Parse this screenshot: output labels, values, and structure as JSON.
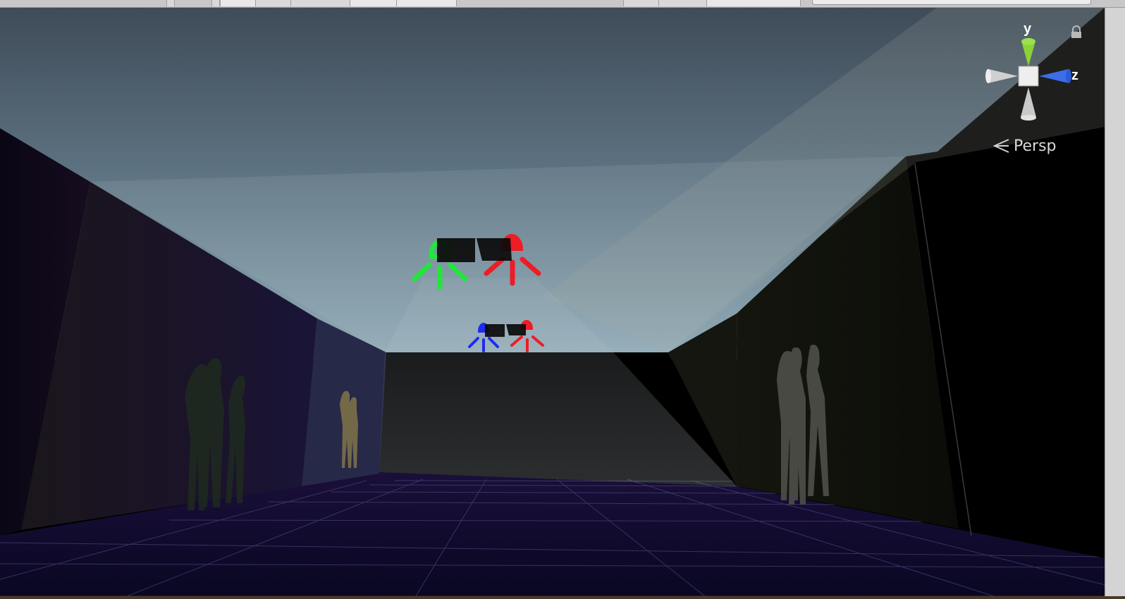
{
  "viewport": {
    "projection_label": "Persp",
    "projection_icon": "perspective-chevron-icon",
    "lock_icon": "lock-icon",
    "gizmo": {
      "y_label": "y",
      "z_label": "z",
      "colors": {
        "y": "#8bd13a",
        "z": "#3c6ee8",
        "neutral": "#d0d0d0",
        "center": "#eeeeee"
      }
    }
  },
  "scene": {
    "sky_top": "#3e4c5c",
    "sky_horizon": "#8aa5b3",
    "floor_color": "#0c0a26",
    "grid_color": "#5a5a8a",
    "light_gizmos": [
      {
        "name": "light-gizmo-green",
        "color": "#22e63a"
      },
      {
        "name": "light-gizmo-red-upper",
        "color": "#ee1c24"
      },
      {
        "name": "light-gizmo-blue",
        "color": "#1e2cf0"
      },
      {
        "name": "light-gizmo-red-lower",
        "color": "#ee1c24"
      }
    ]
  }
}
